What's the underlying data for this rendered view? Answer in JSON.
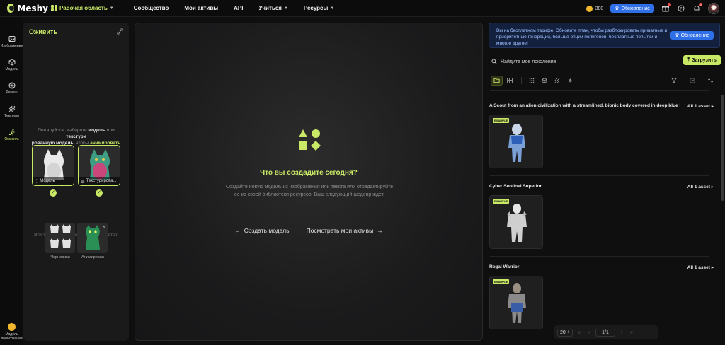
{
  "topbar": {
    "brand": "Meshy",
    "nav": [
      {
        "label": "Рабочая область",
        "has_caret": true
      },
      {
        "label": "Сообщество",
        "has_caret": false
      },
      {
        "label": "Мои активы",
        "has_caret": false
      },
      {
        "label": "API",
        "has_caret": false
      },
      {
        "label": "Учиться",
        "has_caret": true
      },
      {
        "label": "Ресурсы",
        "has_caret": true
      }
    ],
    "credits": "380",
    "upgrade_label": "Обновление",
    "notification_count": "2"
  },
  "rail": {
    "items": [
      {
        "label": "Изображение",
        "icon": "image-icon"
      },
      {
        "label": "Модель",
        "icon": "cube-icon"
      },
      {
        "label": "Ремеш",
        "icon": "remesh-icon"
      },
      {
        "label": "Текстура",
        "icon": "texture-icon"
      },
      {
        "label": "Оживить",
        "icon": "running-figure-icon",
        "active": true
      }
    ],
    "bottom_label": "Модель полосования"
  },
  "animate_panel": {
    "title": "Оживить",
    "hint_prefix": "Пожалуйста, выберите ",
    "hint_model": "модель",
    "hint_or": " или ",
    "hint_texture": "текстури",
    "hint_rest": "рованную модель",
    "hint_to": ", чтобы ",
    "hint_animate": "анимировать",
    "cards": [
      {
        "label": "Модель"
      },
      {
        "label": "Текстурирова..."
      }
    ],
    "unsupported_text": "Эти типы моделей не поддерживаются.",
    "unsupported_cards": [
      {
        "label": "Черновики"
      },
      {
        "label": "Анимирован"
      }
    ]
  },
  "center": {
    "title": "Что вы создадите сегодня?",
    "description": "Создайте новую модель из изображения или текста или отредактируйте ее из своей библиотеки ресурсов. Ваш следующий шедевр ждет.",
    "create_label": "Создать модель",
    "view_label": "Посмотреть мои активы"
  },
  "right": {
    "banner_text": "Вы на бесплатном тарифе. Обновите план, чтобы разблокировать приватные и приоритетные генерации, больше опций полигонов, бесплатные попытки и многое другое!",
    "banner_button": "Обновление",
    "search_placeholder": "Найдите мое поколение",
    "upload_label": "Загрузить",
    "groups": [
      {
        "title": "A Scout from an alien civilization with a streamlined, bionic body covered in deep blue hig...",
        "count": "All 1 asset",
        "tag": "EXAMPLE"
      },
      {
        "title": "Cyber Sentinel Superior",
        "count": "All 1 asset",
        "tag": "EXAMPLE"
      },
      {
        "title": "Regal Warrior",
        "count": "All 1 asset",
        "tag": "EXAMPLE"
      }
    ],
    "pager": {
      "per_page": "20",
      "page": "1/1"
    }
  },
  "colors": {
    "accent": "#c9e866",
    "brand_blue": "#2f6fe8",
    "background": "#0f0f10",
    "panel": "#1a1a1b"
  }
}
